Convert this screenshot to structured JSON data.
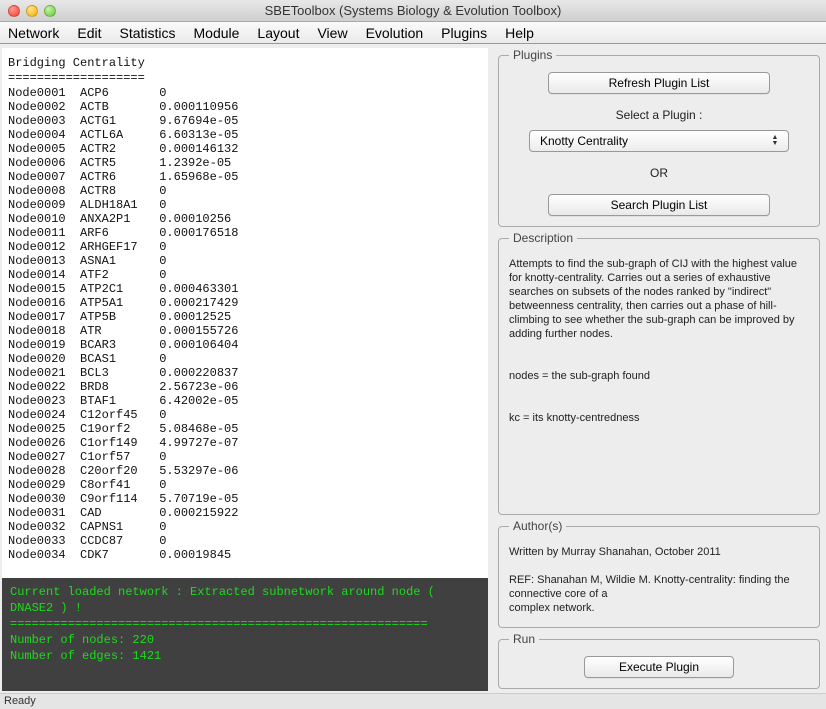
{
  "window": {
    "title": "SBEToolbox (Systems Biology & Evolution Toolbox)"
  },
  "menubar": [
    "Network",
    "Edit",
    "Statistics",
    "Module",
    "Layout",
    "View",
    "Evolution",
    "Plugins",
    "Help"
  ],
  "data_pane": {
    "heading": "Bridging Centrality",
    "divider": "===================",
    "rows": [
      {
        "node": "Node0001",
        "name": "ACP6",
        "val": "0"
      },
      {
        "node": "Node0002",
        "name": "ACTB",
        "val": "0.000110956"
      },
      {
        "node": "Node0003",
        "name": "ACTG1",
        "val": "9.67694e-05"
      },
      {
        "node": "Node0004",
        "name": "ACTL6A",
        "val": "6.60313e-05"
      },
      {
        "node": "Node0005",
        "name": "ACTR2",
        "val": "0.000146132"
      },
      {
        "node": "Node0006",
        "name": "ACTR5",
        "val": "1.2392e-05"
      },
      {
        "node": "Node0007",
        "name": "ACTR6",
        "val": "1.65968e-05"
      },
      {
        "node": "Node0008",
        "name": "ACTR8",
        "val": "0"
      },
      {
        "node": "Node0009",
        "name": "ALDH18A1",
        "val": "0"
      },
      {
        "node": "Node0010",
        "name": "ANXA2P1",
        "val": "0.00010256"
      },
      {
        "node": "Node0011",
        "name": "ARF6",
        "val": "0.000176518"
      },
      {
        "node": "Node0012",
        "name": "ARHGEF17",
        "val": "0"
      },
      {
        "node": "Node0013",
        "name": "ASNA1",
        "val": "0"
      },
      {
        "node": "Node0014",
        "name": "ATF2",
        "val": "0"
      },
      {
        "node": "Node0015",
        "name": "ATP2C1",
        "val": "0.000463301"
      },
      {
        "node": "Node0016",
        "name": "ATP5A1",
        "val": "0.000217429"
      },
      {
        "node": "Node0017",
        "name": "ATP5B",
        "val": "0.00012525"
      },
      {
        "node": "Node0018",
        "name": "ATR",
        "val": "0.000155726"
      },
      {
        "node": "Node0019",
        "name": "BCAR3",
        "val": "0.000106404"
      },
      {
        "node": "Node0020",
        "name": "BCAS1",
        "val": "0"
      },
      {
        "node": "Node0021",
        "name": "BCL3",
        "val": "0.000220837"
      },
      {
        "node": "Node0022",
        "name": "BRD8",
        "val": "2.56723e-06"
      },
      {
        "node": "Node0023",
        "name": "BTAF1",
        "val": "6.42002e-05"
      },
      {
        "node": "Node0024",
        "name": "C12orf45",
        "val": "0"
      },
      {
        "node": "Node0025",
        "name": "C19orf2",
        "val": "5.08468e-05"
      },
      {
        "node": "Node0026",
        "name": "C1orf149",
        "val": "4.99727e-07"
      },
      {
        "node": "Node0027",
        "name": "C1orf57",
        "val": "0"
      },
      {
        "node": "Node0028",
        "name": "C20orf20",
        "val": "5.53297e-06"
      },
      {
        "node": "Node0029",
        "name": "C8orf41",
        "val": "0"
      },
      {
        "node": "Node0030",
        "name": "C9orf114",
        "val": "5.70719e-05"
      },
      {
        "node": "Node0031",
        "name": "CAD",
        "val": "0.000215922"
      },
      {
        "node": "Node0032",
        "name": "CAPNS1",
        "val": "0"
      },
      {
        "node": "Node0033",
        "name": "CCDC87",
        "val": "0"
      },
      {
        "node": "Node0034",
        "name": "CDK7",
        "val": "0.00019845"
      }
    ]
  },
  "console": {
    "line1": "Current loaded network : Extracted subnetwork around node (",
    "line2": "DNASE2 ) !",
    "divider": "==========================================================",
    "nodes": "Number of nodes: 220",
    "edges": "Number of edges: 1421"
  },
  "plugins_panel": {
    "legend": "Plugins",
    "refresh": "Refresh Plugin List",
    "select_label": "Select a Plugin  :",
    "selected": "Knotty Centrality",
    "or": "OR",
    "search": "Search Plugin List"
  },
  "description_panel": {
    "legend": "Description",
    "p1": "Attempts to find the sub-graph of CIJ with the highest value for knotty-centrality. Carries out a series of exhaustive searches on subsets of the nodes ranked by \"indirect\" betweenness centrality, then carries out a phase of hill-climbing to see whether the sub-graph can be improved by adding further nodes.",
    "p2": "nodes = the sub-graph found",
    "p3": "kc = its knotty-centredness"
  },
  "author_panel": {
    "legend": "Author(s)",
    "p1": "Written by Murray Shanahan, October 2011",
    "p2": "REF: Shanahan M, Wildie M. Knotty-centrality: finding the connective core of a",
    "p3": "complex network."
  },
  "run_panel": {
    "legend": "Run",
    "execute": "Execute Plugin"
  },
  "statusbar": "Ready"
}
